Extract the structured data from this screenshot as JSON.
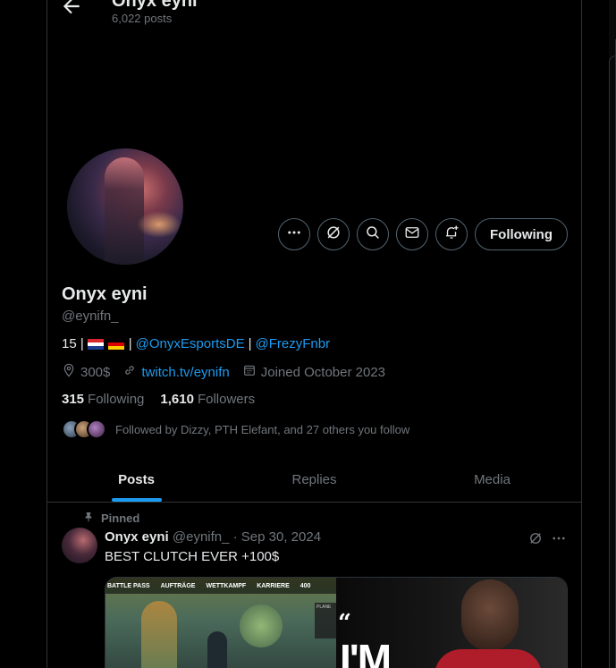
{
  "header": {
    "title": "Onyx eyni",
    "posts_count": "6,022 posts"
  },
  "profile": {
    "name": "Onyx eyni",
    "handle": "@eynifn_",
    "bio": {
      "prefix": "15 |",
      "sep1": "|",
      "mention1": "@OnyxEsportsDE",
      "sep2": "|",
      "mention2": "@FrezyFnbr"
    },
    "location": "300$",
    "website": "twitch.tv/eynifn",
    "joined": "Joined October 2023",
    "following_count": "315",
    "following_label": "Following",
    "followers_count": "1,610",
    "followers_label": "Followers",
    "followed_by": "Followed by Dizzy, PTH Elefant, and 27 others you follow"
  },
  "actions": {
    "following_button": "Following"
  },
  "tabs": [
    {
      "label": "Posts"
    },
    {
      "label": "Replies"
    },
    {
      "label": "Media"
    }
  ],
  "post": {
    "pinned_label": "Pinned",
    "author": "Onyx eyni",
    "handle_date": "@eynifn_ · Sep 30, 2024",
    "text": "BEST CLUTCH EVER +100$",
    "media_left_tabs": [
      "BATTLE PASS",
      "AUFTRÄGE",
      "WETTKAMPF",
      "KARRIERE",
      "400"
    ],
    "media_left_side": "PLANE",
    "media_right_text": "I'M",
    "media_right_quote": "“"
  },
  "colors": {
    "accent": "#1d9bf0",
    "muted": "#71767b",
    "text": "#e7e9ea",
    "border": "#2f3336",
    "background": "#000000"
  }
}
